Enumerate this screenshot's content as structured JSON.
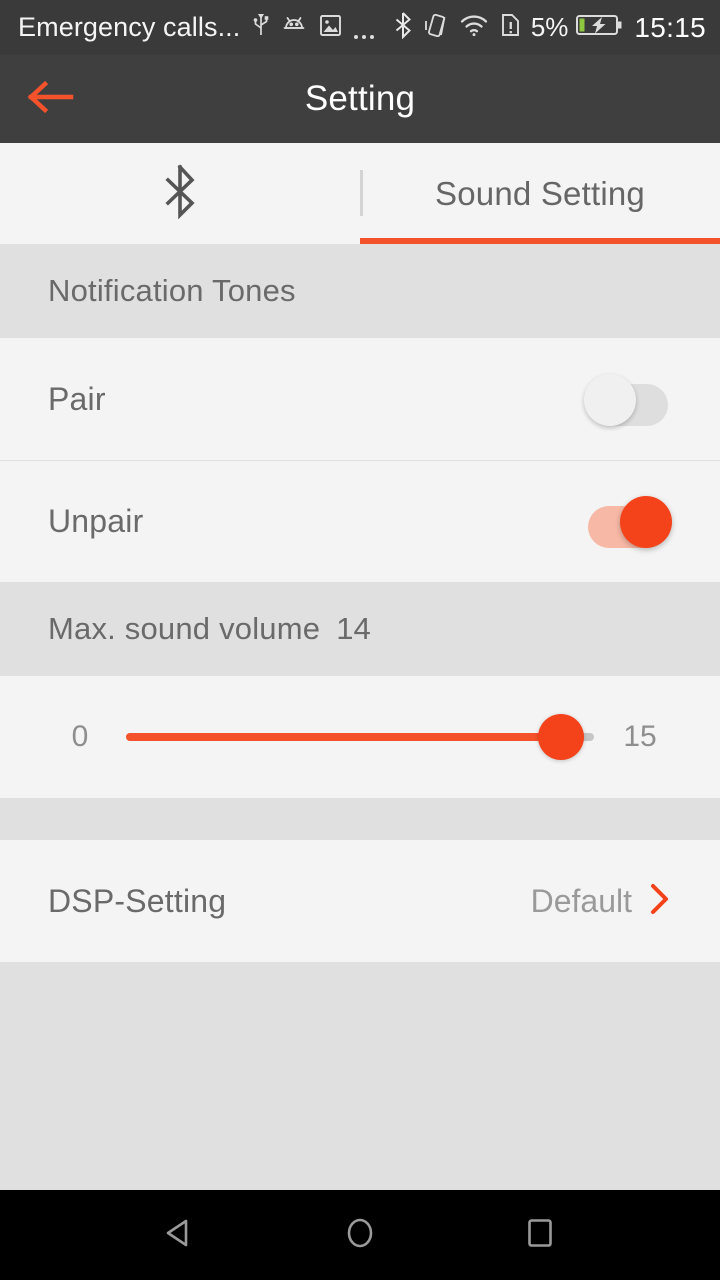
{
  "status_bar": {
    "carrier_text": "Emergency calls...",
    "icons": [
      {
        "name": "usb-icon"
      },
      {
        "name": "android-debug-icon"
      },
      {
        "name": "screenshot-image-icon"
      },
      {
        "name": "more-notifications-icon"
      },
      {
        "name": "bluetooth-icon"
      },
      {
        "name": "vibrate-icon"
      },
      {
        "name": "wifi-icon"
      },
      {
        "name": "sim-card-alert-icon"
      }
    ],
    "battery_percent": "5%",
    "battery_icon": "battery-charging-icon",
    "clock": "15:15"
  },
  "app_bar": {
    "back_icon": "arrow-left-icon",
    "title": "Setting"
  },
  "tabs": [
    {
      "label": "",
      "icon": "bluetooth-icon",
      "active": false,
      "name": "tab-bluetooth"
    },
    {
      "label": "Sound Setting",
      "icon": "",
      "active": true,
      "name": "tab-sound-setting"
    }
  ],
  "sections": {
    "notification_tones": {
      "header": "Notification Tones",
      "rows": [
        {
          "label": "Pair",
          "toggle_on": false
        },
        {
          "label": "Unpair",
          "toggle_on": true
        }
      ]
    },
    "max_sound_volume": {
      "header": "Max. sound volume",
      "value": "14",
      "slider": {
        "min_label": "0",
        "max_label": "15",
        "min": 0,
        "max": 15,
        "value": 14,
        "fill_percent": "93%"
      }
    },
    "dsp": {
      "label": "DSP-Setting",
      "value": "Default",
      "chevron_icon": "chevron-right-icon"
    }
  },
  "nav_bar": {
    "back": "nav-back-icon",
    "home": "nav-home-icon",
    "recents": "nav-recents-icon"
  },
  "colors": {
    "accent": "#f4522a",
    "toggle_on": "#f4421a",
    "app_bar_bg": "#3f3f3f",
    "status_bar_bg": "#3a3a3a",
    "section_bg": "#e0e0e0",
    "row_bg": "#f4f4f4"
  }
}
